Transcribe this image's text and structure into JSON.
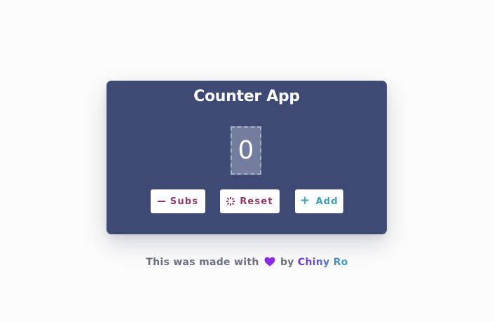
{
  "app": {
    "title": "Counter App",
    "count": "0"
  },
  "buttons": {
    "subs": {
      "label": "Subs",
      "icon": "minus-icon"
    },
    "reset": {
      "label": "Reset",
      "icon": "reset-icon"
    },
    "add": {
      "label": "Add",
      "icon": "plus-icon"
    }
  },
  "footer": {
    "prefix": "This was made with",
    "heart_icon": "heart-icon",
    "heart_color": "#8a2be2",
    "by": "by",
    "author": "Chiny Ro"
  },
  "colors": {
    "card_background": "#3e4a73",
    "count_box_background": "#737e9f",
    "subs_reset_text": "#8e3a66",
    "add_text": "#3f9fb9"
  }
}
